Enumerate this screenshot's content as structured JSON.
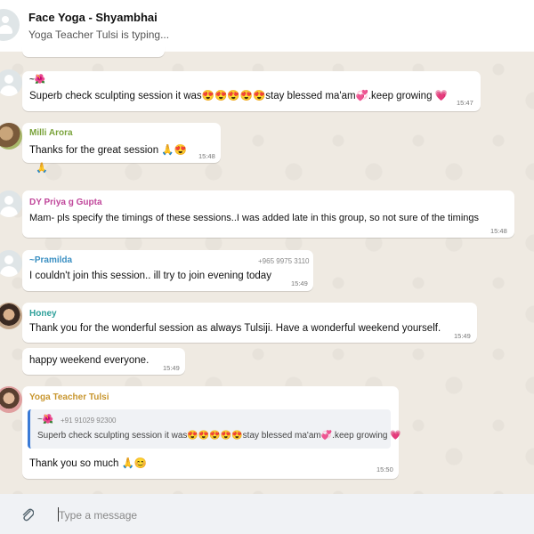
{
  "header": {
    "title": "Face Yoga  - Shyambhai",
    "subtitle": "Yoga Teacher Tulsi is typing..."
  },
  "messages": [
    {
      "sender": "~🌺",
      "text": "Superb check sculpting session it was😍😍😍😍😍stay blessed ma'am💞.keep growing 💗",
      "time": "15:47"
    },
    {
      "sender": "Milli Arora",
      "sender_color": "#7aa33b",
      "text": "Thanks for the great session 🙏😍",
      "time": "15:48",
      "reaction": "🙏"
    },
    {
      "sender": "DY Priya g Gupta",
      "sender_color": "#c0479b",
      "text": "Mam- pls specify the timings of these sessions..I was added late in this group, so not sure of the timings",
      "time": "15:48"
    },
    {
      "sender": "~Pramilda",
      "sender_color": "#3a8fc2",
      "phone": "+965 9975 3110",
      "text": "I couldn't join this session.. ill try to join evening today",
      "time": "15:49"
    },
    {
      "sender": "Honey",
      "sender_color": "#2ea09a",
      "text": "Thank you for the wonderful session as always Tulsiji.  Have a wonderful weekend yourself.",
      "time": "15:49"
    },
    {
      "text": "happy weekend everyone.",
      "time": "15:49"
    },
    {
      "sender": "Yoga Teacher Tulsi",
      "sender_color": "#c8962e",
      "quote": {
        "sender": "~🌺",
        "phone": "+91 91029 92300",
        "text": "Superb check sculpting session it was😍😍😍😍😍stay blessed ma'am💞.keep growing 💗"
      },
      "text": "Thank you so much 🙏😊",
      "time": "15:50"
    }
  ],
  "composer": {
    "placeholder": "Type a message"
  },
  "icons": {
    "attach": "paperclip-icon",
    "group_avatar": "group-avatar-icon",
    "contact_avatar": "person-icon"
  }
}
